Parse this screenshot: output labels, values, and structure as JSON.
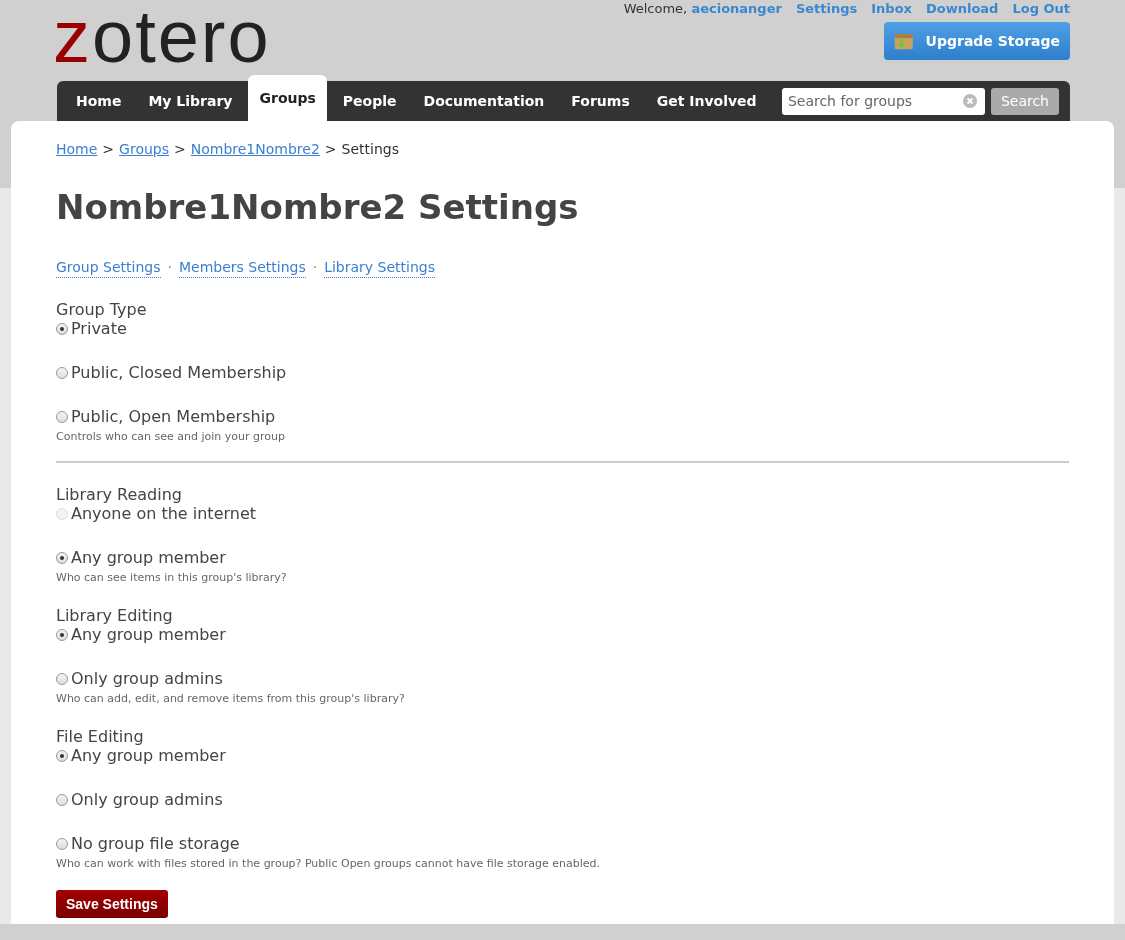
{
  "user_links": {
    "welcome": "Welcome,",
    "user": "aecionanger",
    "links": [
      "Settings",
      "Inbox",
      "Download",
      "Log Out"
    ]
  },
  "logo": {
    "accent": "z",
    "rest": "otero"
  },
  "upgrade_button": "Upgrade Storage",
  "nav": [
    {
      "label": "Home",
      "selected": false
    },
    {
      "label": "My Library",
      "selected": false
    },
    {
      "label": "Groups",
      "selected": true
    },
    {
      "label": "People",
      "selected": false
    },
    {
      "label": "Documentation",
      "selected": false
    },
    {
      "label": "Forums",
      "selected": false
    },
    {
      "label": "Get Involved",
      "selected": false
    }
  ],
  "search": {
    "placeholder": "Search for groups",
    "button": "Search"
  },
  "breadcrumb": {
    "links": [
      "Home",
      "Groups",
      "Nombre1Nombre2"
    ],
    "current": "Settings",
    "separator": ">"
  },
  "title": "Nombre1Nombre2 Settings",
  "subnav": {
    "links": [
      "Group Settings",
      "Members Settings",
      "Library Settings"
    ],
    "separator": "·"
  },
  "sections": [
    {
      "label": "Group Type",
      "options": [
        {
          "label": "Private",
          "selected": true,
          "disabled": false
        },
        {
          "label": "Public, Closed Membership",
          "selected": false,
          "disabled": false
        },
        {
          "label": "Public, Open Membership",
          "selected": false,
          "disabled": false
        }
      ],
      "help": "Controls who can see and join your group",
      "divider": true
    },
    {
      "label": "Library Reading",
      "options": [
        {
          "label": "Anyone on the internet",
          "selected": false,
          "disabled": true
        },
        {
          "label": "Any group member",
          "selected": true,
          "disabled": false
        }
      ],
      "help": "Who can see items in this group's library?",
      "divider": false
    },
    {
      "label": "Library Editing",
      "options": [
        {
          "label": "Any group member",
          "selected": true,
          "disabled": false
        },
        {
          "label": "Only group admins",
          "selected": false,
          "disabled": false
        }
      ],
      "help": "Who can add, edit, and remove items from this group's library?",
      "divider": false
    },
    {
      "label": "File Editing",
      "options": [
        {
          "label": "Any group member",
          "selected": true,
          "disabled": false
        },
        {
          "label": "Only group admins",
          "selected": false,
          "disabled": false
        },
        {
          "label": "No group file storage",
          "selected": false,
          "disabled": false
        }
      ],
      "help": "Who can work with files stored in the group? Public Open groups cannot have file storage enabled.",
      "divider": false
    }
  ],
  "save_button": "Save Settings"
}
